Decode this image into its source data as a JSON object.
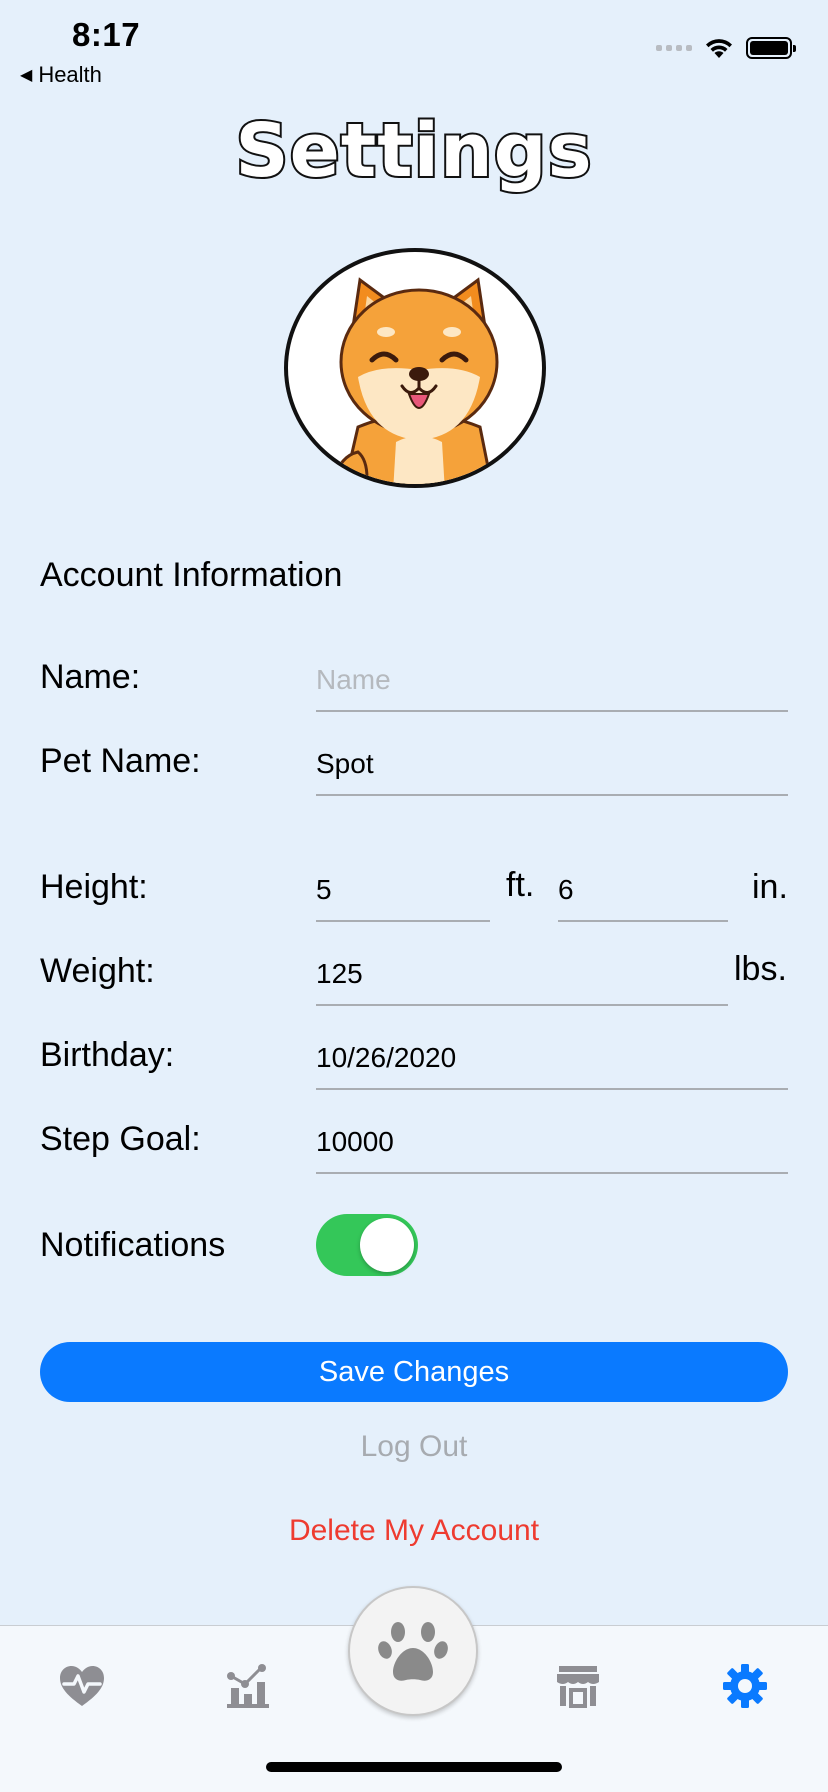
{
  "status_bar": {
    "time": "8:17",
    "back_label": "Health"
  },
  "title": "Settings",
  "section_title": "Account Information",
  "form": {
    "name": {
      "label": "Name:",
      "value": "",
      "placeholder": "Name"
    },
    "pet_name": {
      "label": "Pet Name:",
      "value": "Spot"
    },
    "height": {
      "label": "Height:",
      "feet": "5",
      "feet_unit": "ft.",
      "inches": "6",
      "inches_unit": "in."
    },
    "weight": {
      "label": "Weight:",
      "value": "125",
      "unit": "lbs."
    },
    "birthday": {
      "label": "Birthday:",
      "value": "10/26/2020"
    },
    "step_goal": {
      "label": "Step Goal:",
      "value": "10000"
    },
    "notifications": {
      "label": "Notifications",
      "enabled": true
    }
  },
  "actions": {
    "save": "Save Changes",
    "logout": "Log Out",
    "delete": "Delete My Account"
  },
  "tab_bar": {
    "items": [
      {
        "icon": "heart-pulse-icon",
        "active": false
      },
      {
        "icon": "stats-chart-icon",
        "active": false
      },
      {
        "icon": "paw-icon",
        "active": false
      },
      {
        "icon": "store-icon",
        "active": false
      },
      {
        "icon": "gear-icon",
        "active": true
      }
    ],
    "active_color": "#0a7aff",
    "inactive_color": "#8e8e93"
  },
  "colors": {
    "background": "#e5f0fb",
    "accent": "#0a7aff",
    "toggle_on": "#34c759",
    "danger": "#ee3b30"
  }
}
